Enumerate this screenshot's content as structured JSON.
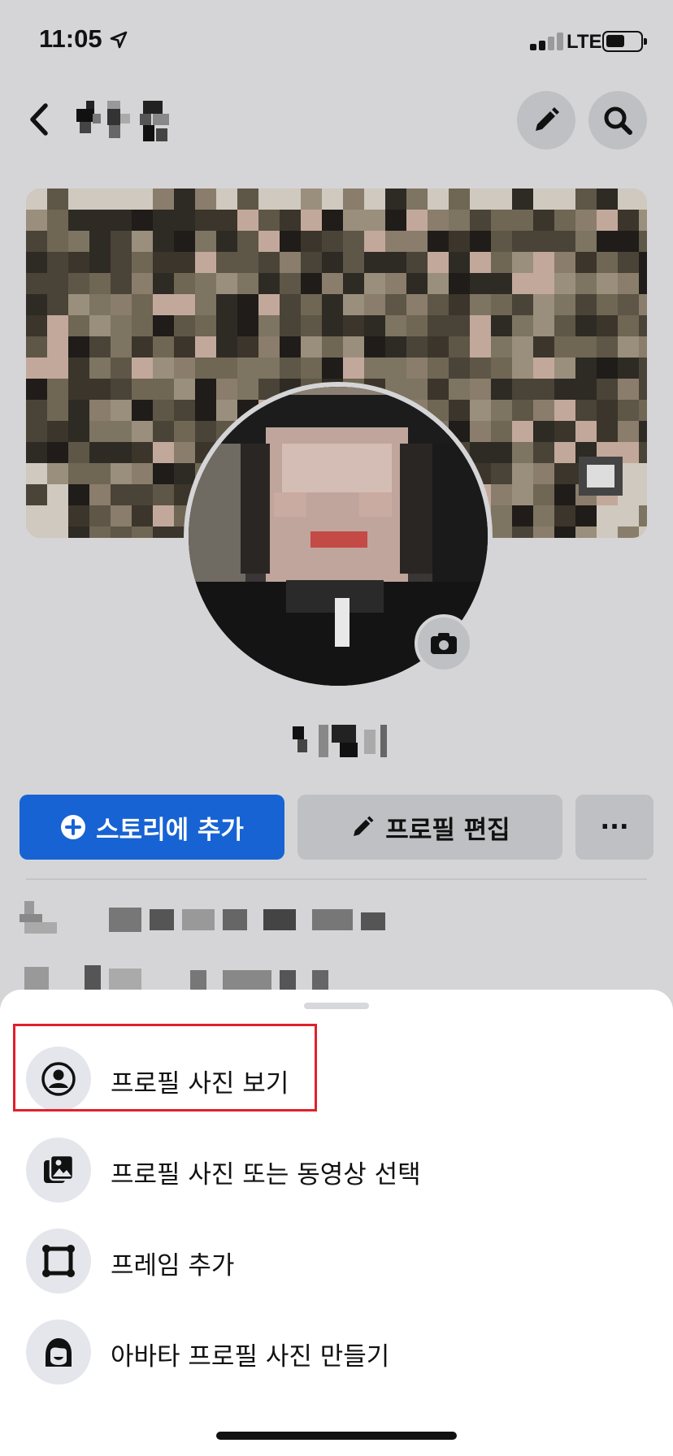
{
  "status_bar": {
    "time": "11:05",
    "network": "LTE"
  },
  "header": {
    "back_icon": "chevron-left-icon",
    "edit_icon": "pencil-icon",
    "search_icon": "search-icon"
  },
  "profile": {
    "camera_icon": "camera-icon"
  },
  "actions": {
    "add_story_label": "스토리에 추가",
    "edit_profile_label": "프로필 편집",
    "more_label": "···"
  },
  "sheet": {
    "items": [
      {
        "label": "프로필 사진 보기",
        "icon": "profile-circle-icon"
      },
      {
        "label": "프로필 사진 또는 동영상 선택",
        "icon": "photo-gallery-icon"
      },
      {
        "label": "프레임 추가",
        "icon": "frame-icon"
      },
      {
        "label": "아바타 프로필 사진 만들기",
        "icon": "avatar-icon"
      }
    ]
  },
  "colors": {
    "primary": "#1763d4",
    "highlight": "#e0202a",
    "dim_background": "#d5d5d7",
    "button_gray": "#bfc0c3"
  }
}
